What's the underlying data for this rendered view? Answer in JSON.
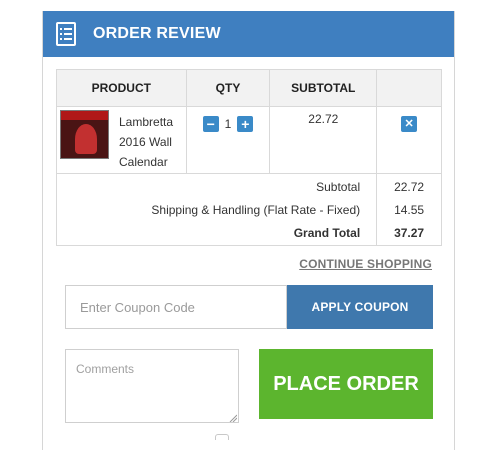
{
  "header": {
    "title": "ORDER REVIEW",
    "icon": "document-list-icon",
    "color": "#3f7fc0"
  },
  "table": {
    "columns": [
      "PRODUCT",
      "QTY",
      "SUBTOTAL",
      ""
    ],
    "items": [
      {
        "thumbnail": "calendar-thumbnail",
        "name": "Lambretta 2016 Wall Calendar",
        "qty": "1",
        "subtotal": "22.72",
        "minus": "−",
        "plus": "+",
        "remove": "✕"
      }
    ],
    "summary": {
      "subtotal_label": "Subtotal",
      "subtotal_value": "22.72",
      "shipping_label": "Shipping & Handling (Flat Rate - Fixed)",
      "shipping_value": "14.55",
      "grand_label": "Grand Total",
      "grand_value": "37.27"
    }
  },
  "continue_link": "CONTINUE SHOPPING",
  "coupon": {
    "placeholder": "Enter Coupon Code",
    "value": "",
    "button": "APPLY COUPON"
  },
  "comments": {
    "placeholder": "Comments",
    "value": ""
  },
  "place_order": {
    "label": "PLACE ORDER",
    "color": "#5cb52e"
  }
}
